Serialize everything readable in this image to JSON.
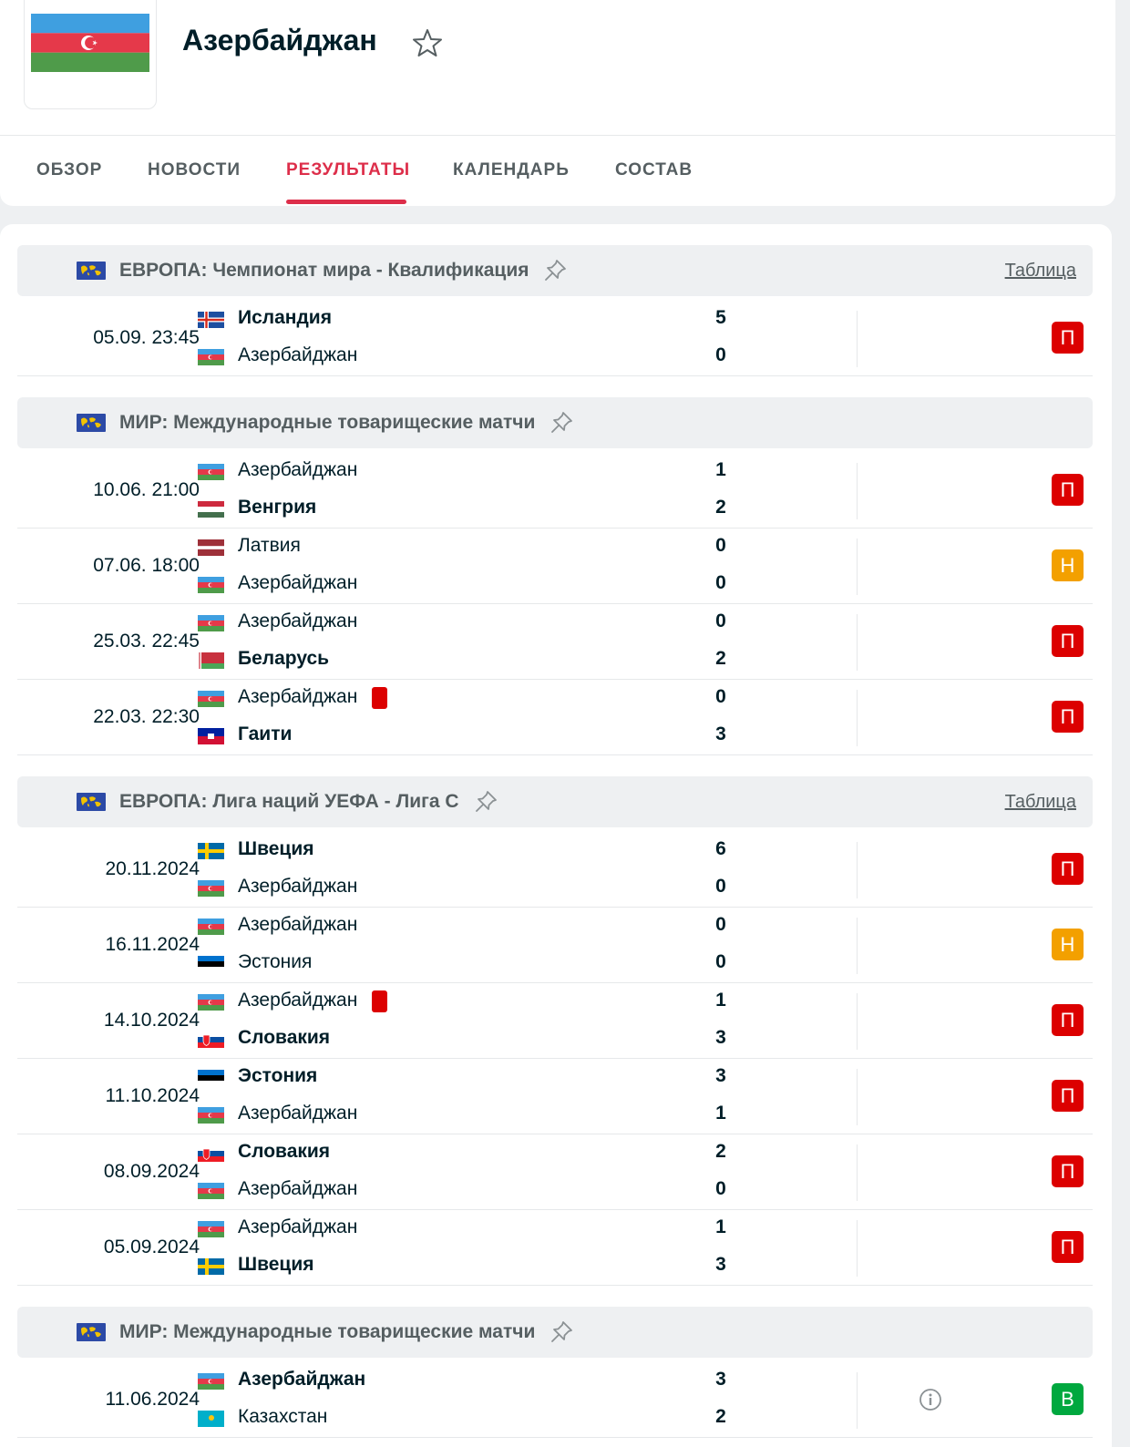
{
  "team": {
    "name": "Азербайджан"
  },
  "tabs": [
    "ОБЗОР",
    "НОВОСТИ",
    "РЕЗУЛЬТАТЫ",
    "КАЛЕНДАРЬ",
    "СОСТАВ"
  ],
  "active_tab": "РЕЗУЛЬТАТЫ",
  "table_link": "Таблица",
  "colors": {
    "accent": "#dd2e4a",
    "loss": "#dc0000",
    "draw": "#f3a000",
    "win": "#00a83f"
  },
  "leagues": [
    {
      "category": "ЕВРОПА:",
      "name": "Чемпионат мира - Квалификация",
      "has_table": true,
      "matches": [
        {
          "time": "05.09. 23:45",
          "home": "Исландия",
          "home_flag": "iceland",
          "home_bold": true,
          "away": "Азербайджан",
          "away_flag": "azerbaijan",
          "away_bold": false,
          "home_score": "5",
          "away_score": "0",
          "result": "П",
          "result_type": "loss"
        }
      ]
    },
    {
      "category": "МИР:",
      "name": "Международные товарищеские матчи",
      "has_table": false,
      "matches": [
        {
          "time": "10.06. 21:00",
          "home": "Азербайджан",
          "home_flag": "azerbaijan",
          "home_bold": false,
          "away": "Венгрия",
          "away_flag": "hungary",
          "away_bold": true,
          "home_score": "1",
          "away_score": "2",
          "result": "П",
          "result_type": "loss"
        },
        {
          "time": "07.06. 18:00",
          "home": "Латвия",
          "home_flag": "latvia",
          "home_bold": false,
          "away": "Азербайджан",
          "away_flag": "azerbaijan",
          "away_bold": false,
          "home_score": "0",
          "away_score": "0",
          "result": "Н",
          "result_type": "draw"
        },
        {
          "time": "25.03. 22:45",
          "home": "Азербайджан",
          "home_flag": "azerbaijan",
          "home_bold": false,
          "away": "Беларусь",
          "away_flag": "belarus",
          "away_bold": true,
          "home_score": "0",
          "away_score": "2",
          "result": "П",
          "result_type": "loss"
        },
        {
          "time": "22.03. 22:30",
          "home": "Азербайджан",
          "home_flag": "azerbaijan",
          "home_bold": false,
          "home_card": true,
          "away": "Гаити",
          "away_flag": "haiti",
          "away_bold": true,
          "home_score": "0",
          "away_score": "3",
          "result": "П",
          "result_type": "loss"
        }
      ]
    },
    {
      "category": "ЕВРОПА:",
      "name": "Лига наций УЕФА - Лига С",
      "has_table": true,
      "matches": [
        {
          "time": "20.11.2024",
          "home": "Швеция",
          "home_flag": "sweden",
          "home_bold": true,
          "away": "Азербайджан",
          "away_flag": "azerbaijan",
          "away_bold": false,
          "home_score": "6",
          "away_score": "0",
          "result": "П",
          "result_type": "loss"
        },
        {
          "time": "16.11.2024",
          "home": "Азербайджан",
          "home_flag": "azerbaijan",
          "home_bold": false,
          "away": "Эстония",
          "away_flag": "estonia",
          "away_bold": false,
          "home_score": "0",
          "away_score": "0",
          "result": "Н",
          "result_type": "draw"
        },
        {
          "time": "14.10.2024",
          "home": "Азербайджан",
          "home_flag": "azerbaijan",
          "home_bold": false,
          "home_card": true,
          "away": "Словакия",
          "away_flag": "slovakia",
          "away_bold": true,
          "home_score": "1",
          "away_score": "3",
          "result": "П",
          "result_type": "loss"
        },
        {
          "time": "11.10.2024",
          "home": "Эстония",
          "home_flag": "estonia",
          "home_bold": true,
          "away": "Азербайджан",
          "away_flag": "azerbaijan",
          "away_bold": false,
          "home_score": "3",
          "away_score": "1",
          "result": "П",
          "result_type": "loss"
        },
        {
          "time": "08.09.2024",
          "home": "Словакия",
          "home_flag": "slovakia",
          "home_bold": true,
          "away": "Азербайджан",
          "away_flag": "azerbaijan",
          "away_bold": false,
          "home_score": "2",
          "away_score": "0",
          "result": "П",
          "result_type": "loss"
        },
        {
          "time": "05.09.2024",
          "home": "Азербайджан",
          "home_flag": "azerbaijan",
          "home_bold": false,
          "away": "Швеция",
          "away_flag": "sweden",
          "away_bold": true,
          "home_score": "1",
          "away_score": "3",
          "result": "П",
          "result_type": "loss"
        }
      ]
    },
    {
      "category": "МИР:",
      "name": "Международные товарищеские матчи",
      "has_table": false,
      "matches": [
        {
          "time": "11.06.2024",
          "home": "Азербайджан",
          "home_flag": "azerbaijan",
          "home_bold": true,
          "away": "Казахстан",
          "away_flag": "kazakhstan",
          "away_bold": false,
          "home_score": "3",
          "away_score": "2",
          "result": "В",
          "result_type": "win",
          "info_icon": true
        }
      ]
    }
  ]
}
